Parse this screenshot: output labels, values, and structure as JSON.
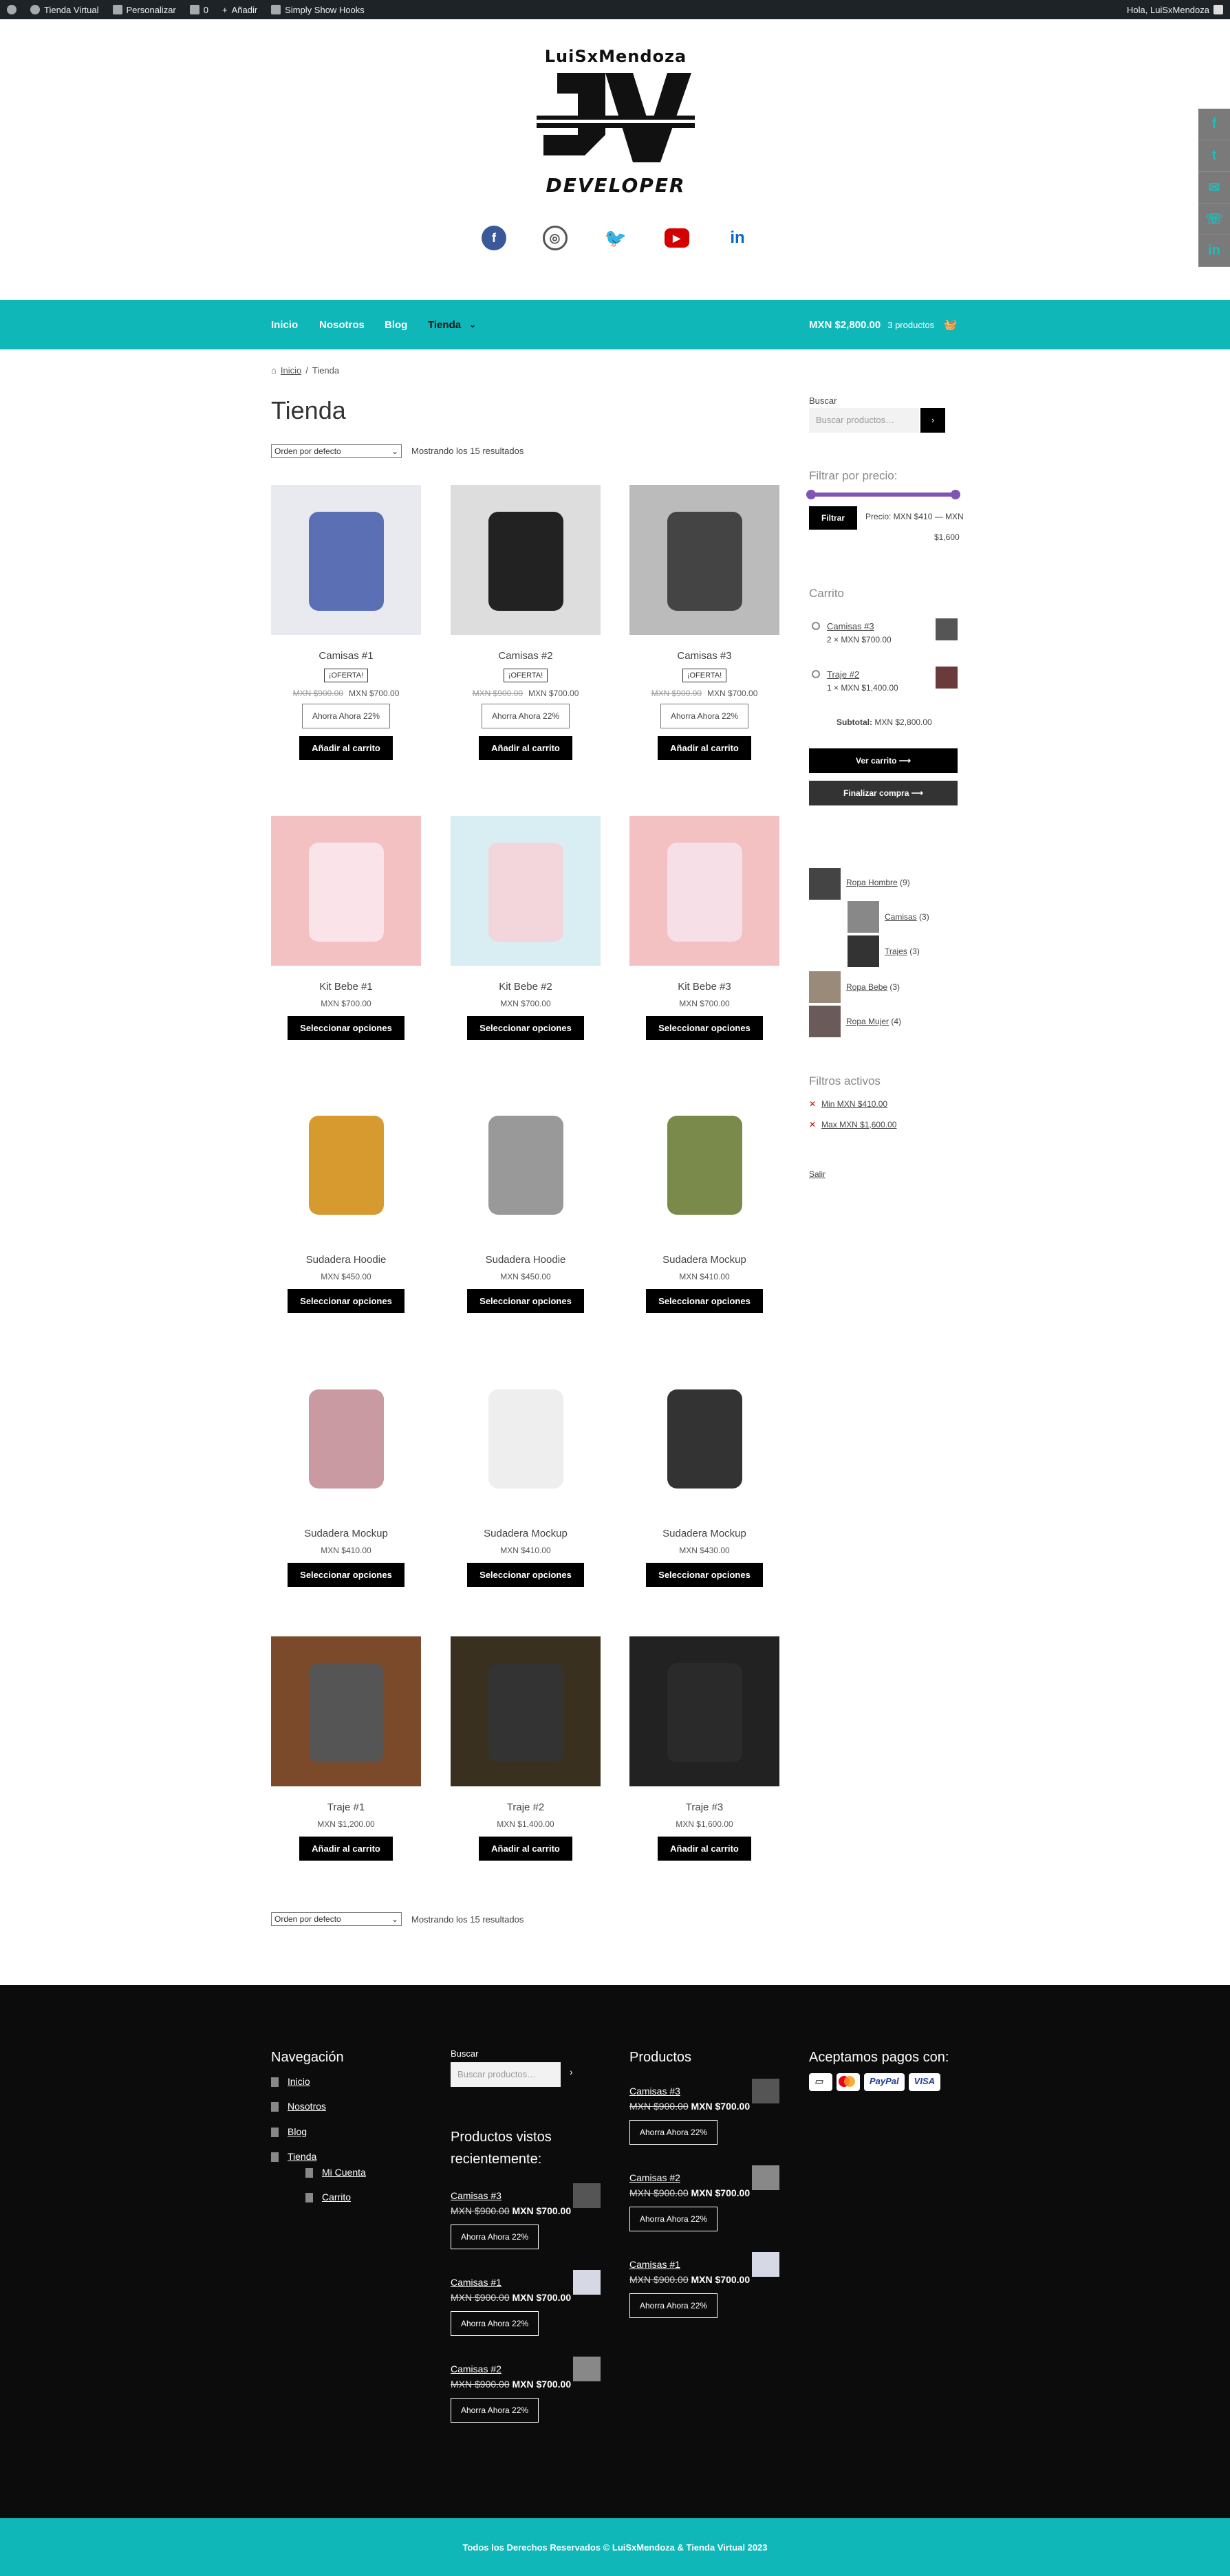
{
  "admin_bar": {
    "site": "Tienda Virtual",
    "customize": "Personalizar",
    "comments": "0",
    "new": "Añadir",
    "plugin": "Simply Show Hooks",
    "greeting": "Hola, LuiSxMendoza"
  },
  "logo": {
    "top": "LuiSxMendoza",
    "bottom": "DEVELOPER"
  },
  "nav": {
    "items": [
      "Inicio",
      "Nosotros",
      "Blog",
      "Tienda"
    ],
    "cart_total": "MXN $2,800.00",
    "cart_count": "3 productos"
  },
  "breadcrumb": {
    "home": "Inicio",
    "current": "Tienda"
  },
  "page_title": "Tienda",
  "sort": {
    "value": "Orden por defecto",
    "count": "Mostrando los 15 resultados"
  },
  "products": [
    {
      "name": "Camisas #1",
      "badge": "¡OFERTA!",
      "old": "MXN $900.00",
      "price": "MXN $700.00",
      "save": "Ahorra Ahora 22%",
      "button": "Añadir al carrito"
    },
    {
      "name": "Camisas #2",
      "badge": "¡OFERTA!",
      "old": "MXN $900.00",
      "price": "MXN $700.00",
      "save": "Ahorra Ahora 22%",
      "button": "Añadir al carrito"
    },
    {
      "name": "Camisas #3",
      "badge": "¡OFERTA!",
      "old": "MXN $900.00",
      "price": "MXN $700.00",
      "save": "Ahorra Ahora 22%",
      "button": "Añadir al carrito"
    },
    {
      "name": "Kit Bebe #1",
      "price": "MXN $700.00",
      "button": "Seleccionar opciones"
    },
    {
      "name": "Kit Bebe #2",
      "price": "MXN $700.00",
      "button": "Seleccionar opciones"
    },
    {
      "name": "Kit Bebe #3",
      "price": "MXN $700.00",
      "button": "Seleccionar opciones"
    },
    {
      "name": "Sudadera Hoodie",
      "price": "MXN $450.00",
      "button": "Seleccionar opciones"
    },
    {
      "name": "Sudadera Hoodie",
      "price": "MXN $450.00",
      "button": "Seleccionar opciones"
    },
    {
      "name": "Sudadera Mockup",
      "price": "MXN $410.00",
      "button": "Seleccionar opciones"
    },
    {
      "name": "Sudadera Mockup",
      "price": "MXN $410.00",
      "button": "Seleccionar opciones"
    },
    {
      "name": "Sudadera Mockup",
      "price": "MXN $410.00",
      "button": "Seleccionar opciones"
    },
    {
      "name": "Sudadera Mockup",
      "price": "MXN $430.00",
      "button": "Seleccionar opciones"
    },
    {
      "name": "Traje #1",
      "price": "MXN $1,200.00",
      "button": "Añadir al carrito"
    },
    {
      "name": "Traje #2",
      "price": "MXN $1,400.00",
      "button": "Añadir al carrito"
    },
    {
      "name": "Traje #3",
      "price": "MXN $1,600.00",
      "button": "Añadir al carrito"
    }
  ],
  "sidebar": {
    "search_label": "Buscar",
    "search_placeholder": "Buscar productos…",
    "filter_title": "Filtrar por precio:",
    "filter_button": "Filtrar",
    "filter_range": "Precio: MXN $410 — MXN",
    "filter_range2": "$1,600",
    "cart_title": "Carrito",
    "cart_items": [
      {
        "name": "Camisas #3",
        "qty": "2 × MXN $700.00"
      },
      {
        "name": "Traje #2",
        "qty": "1 × MXN $1,400.00"
      }
    ],
    "subtotal_label": "Subtotal:",
    "subtotal": "MXN $2,800.00",
    "view_cart": "Ver carrito",
    "checkout": "Finalizar compra",
    "categories": [
      {
        "name": "Ropa Hombre",
        "count": "(9)"
      },
      {
        "name": "Camisas",
        "count": "(3)"
      },
      {
        "name": "Trajes",
        "count": "(3)"
      },
      {
        "name": "Ropa Bebe",
        "count": "(3)"
      },
      {
        "name": "Ropa Mujer",
        "count": "(4)"
      }
    ],
    "active_title": "Filtros activos",
    "active": [
      "Min MXN $410.00",
      "Max MXN $1,600.00"
    ],
    "exit": "Salir"
  },
  "footer": {
    "nav_title": "Navegación",
    "nav": [
      "Inicio",
      "Nosotros",
      "Blog",
      "Tienda",
      "Mi Cuenta",
      "Carrito"
    ],
    "search_label": "Buscar",
    "search_placeholder": "Buscar productos…",
    "recent_title1": "Productos vistos",
    "recent_title2": "recientemente:",
    "recent": [
      {
        "name": "Camisas #3",
        "old": "MXN $900.00",
        "price": "MXN $700.00",
        "save": "Ahorra Ahora 22%"
      },
      {
        "name": "Camisas #1",
        "old": "MXN $900.00",
        "price": "MXN $700.00",
        "save": "Ahorra Ahora 22%"
      },
      {
        "name": "Camisas #2",
        "old": "MXN $900.00",
        "price": "MXN $700.00",
        "save": "Ahorra Ahora 22%"
      }
    ],
    "products_title": "Productos",
    "products": [
      {
        "name": "Camisas #3",
        "old": "MXN $900.00",
        "price": "MXN $700.00",
        "save": "Ahorra Ahora 22%"
      },
      {
        "name": "Camisas #2",
        "old": "MXN $900.00",
        "price": "MXN $700.00",
        "save": "Ahorra Ahora 22%"
      },
      {
        "name": "Camisas #1",
        "old": "MXN $900.00",
        "price": "MXN $700.00",
        "save": "Ahorra Ahora 22%"
      }
    ],
    "pay_title": "Aceptamos pagos con:",
    "cards": [
      "PayPal",
      "VISA"
    ]
  },
  "copyright": "Todos los Derechos Reservados © LuiSxMendoza & Tienda Virtual 2023",
  "colors": {
    "accent": "#0fb7b9",
    "slider": "#7f54b3",
    "dark": "#0c0c0c"
  }
}
